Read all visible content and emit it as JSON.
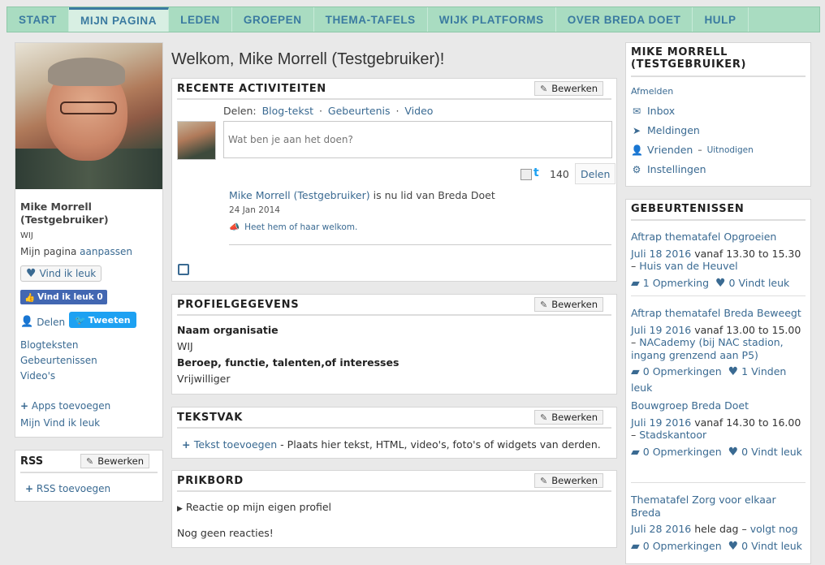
{
  "nav": {
    "tabs": [
      {
        "label": "START"
      },
      {
        "label": "MIJN PAGINA"
      },
      {
        "label": "LEDEN"
      },
      {
        "label": "GROEPEN"
      },
      {
        "label": "THEMA-TAFELS"
      },
      {
        "label": "WIJK PLATFORMS"
      },
      {
        "label": "OVER BREDA DOET"
      },
      {
        "label": "HULP"
      }
    ],
    "active": "MIJN PAGINA"
  },
  "profile": {
    "name": "Mike Morrell (Testgebruiker)",
    "subtitle": "WIJ",
    "page_label": "Mijn pagina",
    "edit_link": "aanpassen",
    "like_button": "Vind ik leuk",
    "fb_like": "Vind ik leuk 0",
    "share": "Delen",
    "tweet": "Tweeten",
    "links": [
      "Blogteksten",
      "Gebeurtenissen",
      "Video's"
    ],
    "apps_add": "Apps toevoegen",
    "my_likes": "Mijn Vind ik leuk"
  },
  "rss": {
    "title": "RSS",
    "edit": "Bewerken",
    "add": "RSS toevoegen"
  },
  "welcome": "Welkom, Mike Morrell (Testgebruiker)!",
  "activities": {
    "title": "RECENTE ACTIVITEITEN",
    "edit": "Bewerken",
    "share_label": "Delen:",
    "share_options": [
      "Blog-tekst",
      "Gebeurtenis",
      "Video"
    ],
    "placeholder": "Wat ben je aan het doen?",
    "char_count": "140",
    "submit": "Delen",
    "activity_user": "Mike Morrell (Testgebruiker)",
    "activity_text": "is nu lid van Breda Doet",
    "activity_date": "24 Jan 2014",
    "activity_welcome": "Heet hem of haar welkom."
  },
  "profile_info": {
    "title": "PROFIELGEGEVENS",
    "edit": "Bewerken",
    "fields": [
      {
        "label": "Naam organisatie",
        "value": "WIJ"
      },
      {
        "label": "Beroep, functie, talenten,of interesses",
        "value": "Vrijwilliger"
      }
    ]
  },
  "textbox": {
    "title": "TEKSTVAK",
    "edit": "Bewerken",
    "add_link": "Tekst toevoegen",
    "add_text": "- Plaats hier tekst, HTML, video's, foto's of widgets van derden."
  },
  "board": {
    "title": "PRIKBORD",
    "edit": "Bewerken",
    "toggle": "Reactie op mijn eigen profiel",
    "empty": "Nog geen reacties!"
  },
  "user_menu": {
    "title": "MIKE MORRELL (TESTGEBRUIKER)",
    "logout": "Afmelden",
    "inbox": "Inbox",
    "notifications": "Meldingen",
    "friends": "Vrienden",
    "invite": "Uitnodigen",
    "settings": "Instellingen"
  },
  "events": {
    "title": "GEBEURTENISSEN",
    "items": [
      {
        "title": "Aftrap thematafel Opgroeien",
        "date": "Juli 18 2016",
        "time": "vanaf 13.30 to 15.30 –",
        "location": "Huis van de Heuvel",
        "comments": "1 Opmerking",
        "likes": "0 Vindt leuk"
      },
      {
        "title": "Aftrap thematafel Breda Beweegt",
        "date": "Juli 19 2016",
        "time": "vanaf 13.00 to 15.00 –",
        "location": "NACademy (bij NAC stadion, ingang grenzend aan P5)",
        "comments": "0 Opmerkingen",
        "likes": "1 Vinden leuk"
      },
      {
        "title": "Bouwgroep Breda Doet",
        "date": "Juli 19 2016",
        "time": "vanaf 14.30 to 16.00 –",
        "location": "Stadskantoor",
        "comments": "0 Opmerkingen",
        "likes": "0 Vindt leuk"
      },
      {
        "title": "Thematafel Zorg voor elkaar Breda",
        "date": "Juli 28 2016",
        "time": "hele dag –",
        "location": "volgt nog",
        "comments": "0 Opmerkingen",
        "likes": "0 Vindt leuk"
      }
    ]
  },
  "colors": {
    "nav_bg": "#a9dcc1",
    "link": "#3a6a92",
    "page_bg": "#e9e9e9"
  }
}
